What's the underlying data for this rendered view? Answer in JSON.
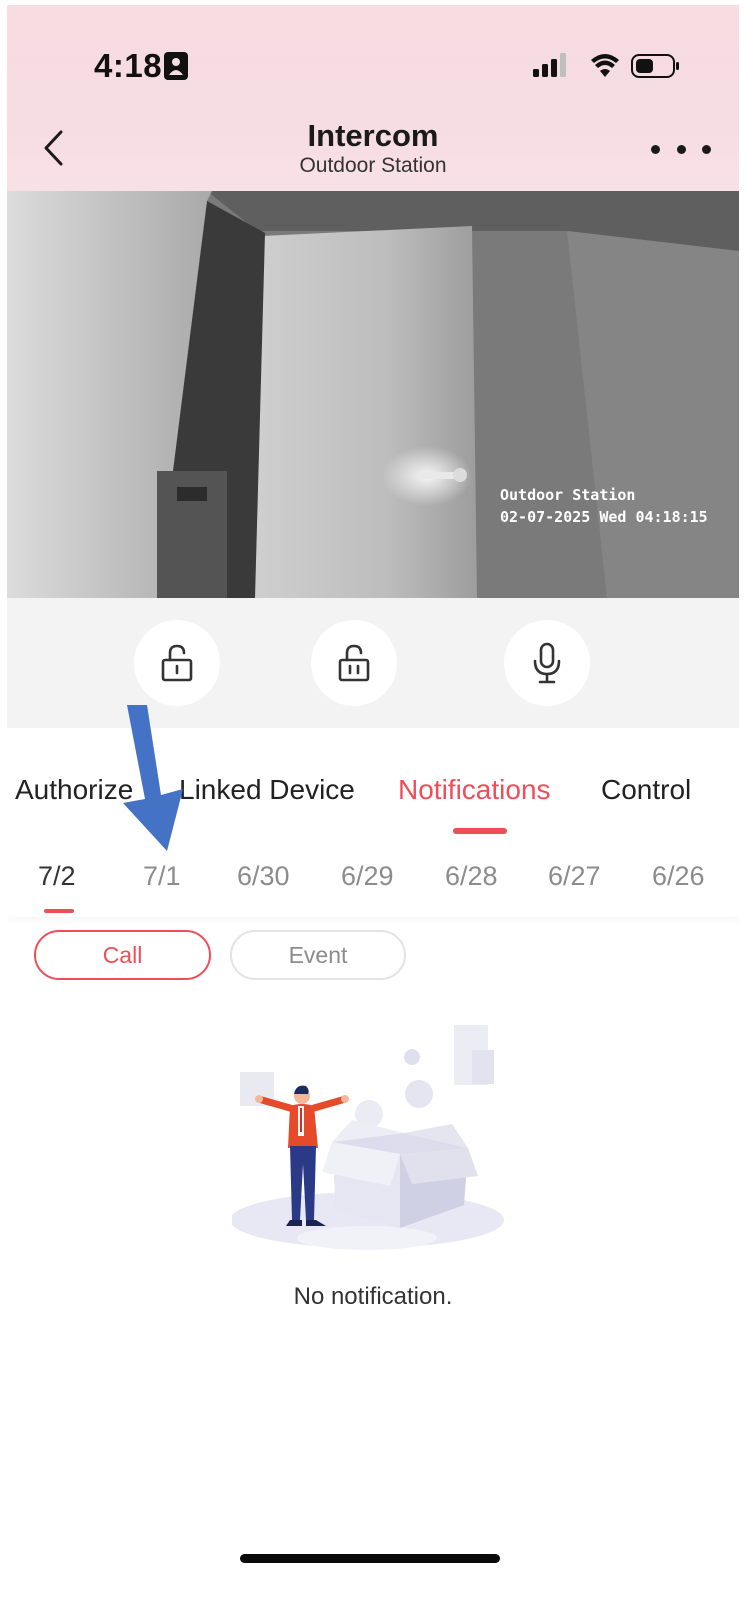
{
  "status_bar": {
    "time": "4:18"
  },
  "header": {
    "title": "Intercom",
    "subtitle": "Outdoor Station"
  },
  "video": {
    "osd_line1": "Outdoor Station",
    "osd_line2": "02-07-2025 Wed 04:18:15"
  },
  "controls": [
    {
      "icon": "unlock-icon"
    },
    {
      "icon": "unlock-secondary-icon"
    },
    {
      "icon": "microphone-icon"
    }
  ],
  "tabs": {
    "items": [
      "Authorize",
      "Linked Device",
      "Notifications",
      "Control"
    ],
    "active": "Notifications"
  },
  "dates": {
    "items": [
      "7/2",
      "7/1",
      "6/30",
      "6/29",
      "6/28",
      "6/27",
      "6/26"
    ],
    "active": "7/2"
  },
  "filters": {
    "items": [
      "Call",
      "Event"
    ],
    "active": "Call"
  },
  "empty_state": {
    "message": "No notification."
  },
  "colors": {
    "accent": "#ee4e58",
    "annotation_arrow": "#4472c4"
  }
}
